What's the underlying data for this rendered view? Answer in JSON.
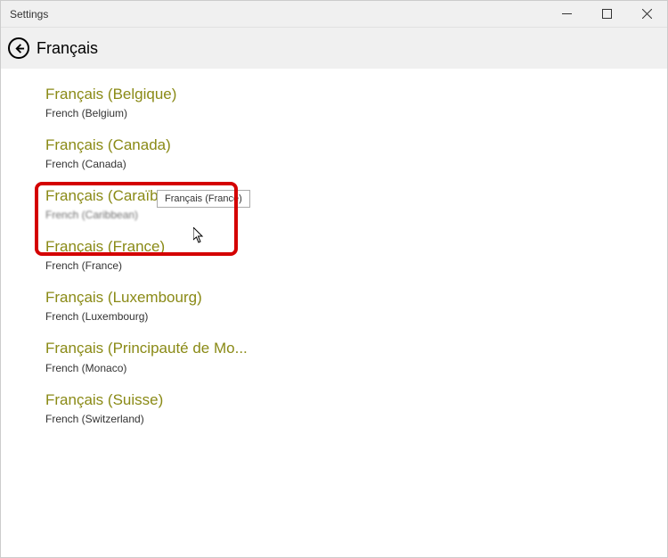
{
  "titlebar": {
    "title": "Settings"
  },
  "header": {
    "title": "Français"
  },
  "tooltip": "Français (France)",
  "languages": [
    {
      "native": "Français (Belgique)",
      "english": "French (Belgium)"
    },
    {
      "native": "Français (Canada)",
      "english": "French (Canada)"
    },
    {
      "native": "Français (Caraïbe)",
      "english": "French (Caribbean)"
    },
    {
      "native": "Français (France)",
      "english": "French (France)"
    },
    {
      "native": "Français (Luxembourg)",
      "english": "French (Luxembourg)"
    },
    {
      "native": "Français (Principauté de Mo...",
      "english": "French (Monaco)"
    },
    {
      "native": "Français (Suisse)",
      "english": "French (Switzerland)"
    }
  ]
}
